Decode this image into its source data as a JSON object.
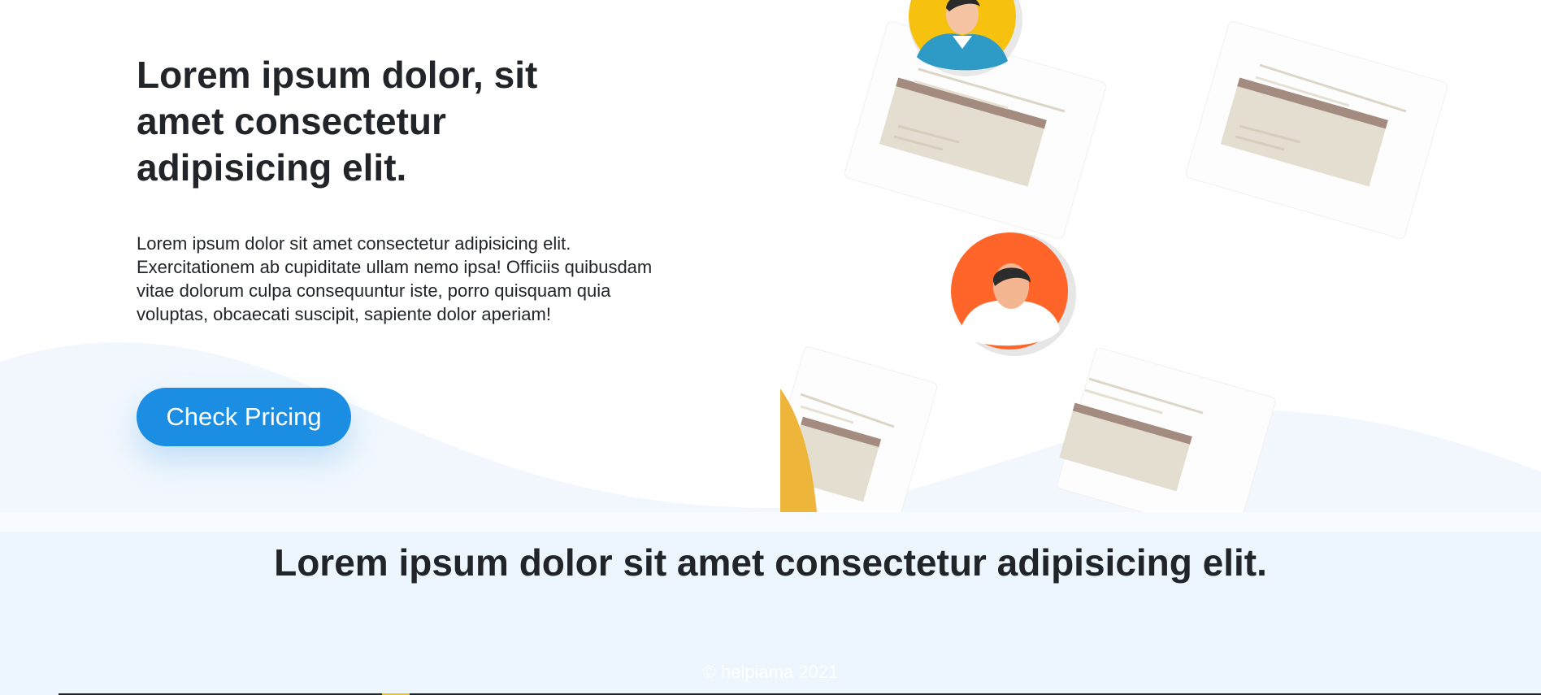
{
  "hero": {
    "title": "Lorem ipsum dolor, sit amet consectetur adipisicing elit.",
    "text": "Lorem ipsum dolor sit amet consectetur adipisicing elit. Exercitationem ab cupiditate ullam nemo ipsa! Officiis quibusdam vitae dolorum culpa consequuntur iste, porro quisquam quia voluptas, obcaecati suscipit, sapiente dolor aperiam!",
    "cta_label": "Check Pricing"
  },
  "section": {
    "title": "Lorem ipsum dolor sit amet consectetur adipisicing elit."
  },
  "footer": {
    "copyright": "© helpiama 2021"
  },
  "colors": {
    "accent": "#1b8ee3",
    "wave": "#eef6fd",
    "text": "#212529",
    "avatar_yellow": "#f7c20f",
    "avatar_orange": "#ff6428"
  },
  "icons": [
    "avatar-man-yellow-bg",
    "avatar-man-orange-bg",
    "document-card"
  ]
}
